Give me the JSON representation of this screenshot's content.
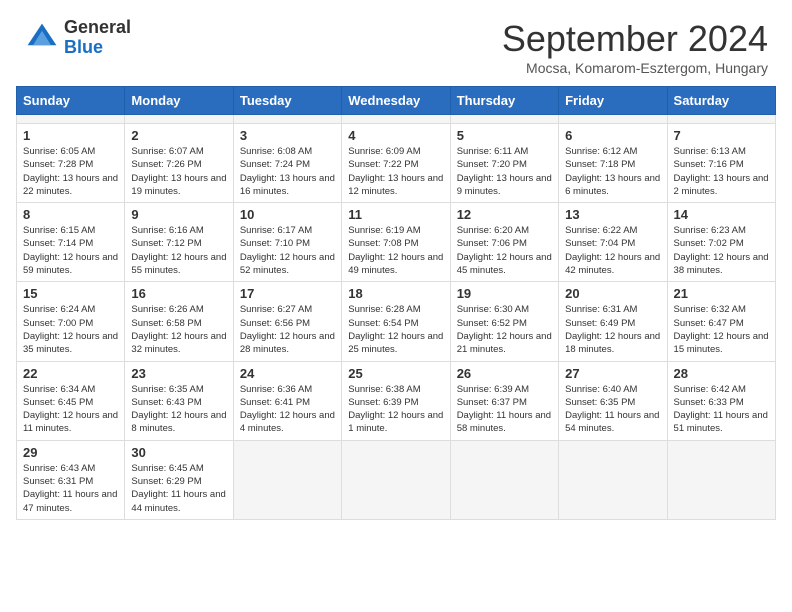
{
  "header": {
    "logo_general": "General",
    "logo_blue": "Blue",
    "title": "September 2024",
    "location": "Mocsa, Komarom-Esztergom, Hungary"
  },
  "calendar": {
    "days_of_week": [
      "Sunday",
      "Monday",
      "Tuesday",
      "Wednesday",
      "Thursday",
      "Friday",
      "Saturday"
    ],
    "weeks": [
      [
        {
          "day": "",
          "empty": true
        },
        {
          "day": "",
          "empty": true
        },
        {
          "day": "",
          "empty": true
        },
        {
          "day": "",
          "empty": true
        },
        {
          "day": "",
          "empty": true
        },
        {
          "day": "",
          "empty": true
        },
        {
          "day": "",
          "empty": true
        }
      ],
      [
        {
          "day": "1",
          "sunrise": "6:05 AM",
          "sunset": "7:28 PM",
          "daylight": "13 hours and 22 minutes."
        },
        {
          "day": "2",
          "sunrise": "6:07 AM",
          "sunset": "7:26 PM",
          "daylight": "13 hours and 19 minutes."
        },
        {
          "day": "3",
          "sunrise": "6:08 AM",
          "sunset": "7:24 PM",
          "daylight": "13 hours and 16 minutes."
        },
        {
          "day": "4",
          "sunrise": "6:09 AM",
          "sunset": "7:22 PM",
          "daylight": "13 hours and 12 minutes."
        },
        {
          "day": "5",
          "sunrise": "6:11 AM",
          "sunset": "7:20 PM",
          "daylight": "13 hours and 9 minutes."
        },
        {
          "day": "6",
          "sunrise": "6:12 AM",
          "sunset": "7:18 PM",
          "daylight": "13 hours and 6 minutes."
        },
        {
          "day": "7",
          "sunrise": "6:13 AM",
          "sunset": "7:16 PM",
          "daylight": "13 hours and 2 minutes."
        }
      ],
      [
        {
          "day": "8",
          "sunrise": "6:15 AM",
          "sunset": "7:14 PM",
          "daylight": "12 hours and 59 minutes."
        },
        {
          "day": "9",
          "sunrise": "6:16 AM",
          "sunset": "7:12 PM",
          "daylight": "12 hours and 55 minutes."
        },
        {
          "day": "10",
          "sunrise": "6:17 AM",
          "sunset": "7:10 PM",
          "daylight": "12 hours and 52 minutes."
        },
        {
          "day": "11",
          "sunrise": "6:19 AM",
          "sunset": "7:08 PM",
          "daylight": "12 hours and 49 minutes."
        },
        {
          "day": "12",
          "sunrise": "6:20 AM",
          "sunset": "7:06 PM",
          "daylight": "12 hours and 45 minutes."
        },
        {
          "day": "13",
          "sunrise": "6:22 AM",
          "sunset": "7:04 PM",
          "daylight": "12 hours and 42 minutes."
        },
        {
          "day": "14",
          "sunrise": "6:23 AM",
          "sunset": "7:02 PM",
          "daylight": "12 hours and 38 minutes."
        }
      ],
      [
        {
          "day": "15",
          "sunrise": "6:24 AM",
          "sunset": "7:00 PM",
          "daylight": "12 hours and 35 minutes."
        },
        {
          "day": "16",
          "sunrise": "6:26 AM",
          "sunset": "6:58 PM",
          "daylight": "12 hours and 32 minutes."
        },
        {
          "day": "17",
          "sunrise": "6:27 AM",
          "sunset": "6:56 PM",
          "daylight": "12 hours and 28 minutes."
        },
        {
          "day": "18",
          "sunrise": "6:28 AM",
          "sunset": "6:54 PM",
          "daylight": "12 hours and 25 minutes."
        },
        {
          "day": "19",
          "sunrise": "6:30 AM",
          "sunset": "6:52 PM",
          "daylight": "12 hours and 21 minutes."
        },
        {
          "day": "20",
          "sunrise": "6:31 AM",
          "sunset": "6:49 PM",
          "daylight": "12 hours and 18 minutes."
        },
        {
          "day": "21",
          "sunrise": "6:32 AM",
          "sunset": "6:47 PM",
          "daylight": "12 hours and 15 minutes."
        }
      ],
      [
        {
          "day": "22",
          "sunrise": "6:34 AM",
          "sunset": "6:45 PM",
          "daylight": "12 hours and 11 minutes."
        },
        {
          "day": "23",
          "sunrise": "6:35 AM",
          "sunset": "6:43 PM",
          "daylight": "12 hours and 8 minutes."
        },
        {
          "day": "24",
          "sunrise": "6:36 AM",
          "sunset": "6:41 PM",
          "daylight": "12 hours and 4 minutes."
        },
        {
          "day": "25",
          "sunrise": "6:38 AM",
          "sunset": "6:39 PM",
          "daylight": "12 hours and 1 minute."
        },
        {
          "day": "26",
          "sunrise": "6:39 AM",
          "sunset": "6:37 PM",
          "daylight": "11 hours and 58 minutes."
        },
        {
          "day": "27",
          "sunrise": "6:40 AM",
          "sunset": "6:35 PM",
          "daylight": "11 hours and 54 minutes."
        },
        {
          "day": "28",
          "sunrise": "6:42 AM",
          "sunset": "6:33 PM",
          "daylight": "11 hours and 51 minutes."
        }
      ],
      [
        {
          "day": "29",
          "sunrise": "6:43 AM",
          "sunset": "6:31 PM",
          "daylight": "11 hours and 47 minutes."
        },
        {
          "day": "30",
          "sunrise": "6:45 AM",
          "sunset": "6:29 PM",
          "daylight": "11 hours and 44 minutes."
        },
        {
          "day": "",
          "empty": true
        },
        {
          "day": "",
          "empty": true
        },
        {
          "day": "",
          "empty": true
        },
        {
          "day": "",
          "empty": true
        },
        {
          "day": "",
          "empty": true
        }
      ]
    ]
  }
}
